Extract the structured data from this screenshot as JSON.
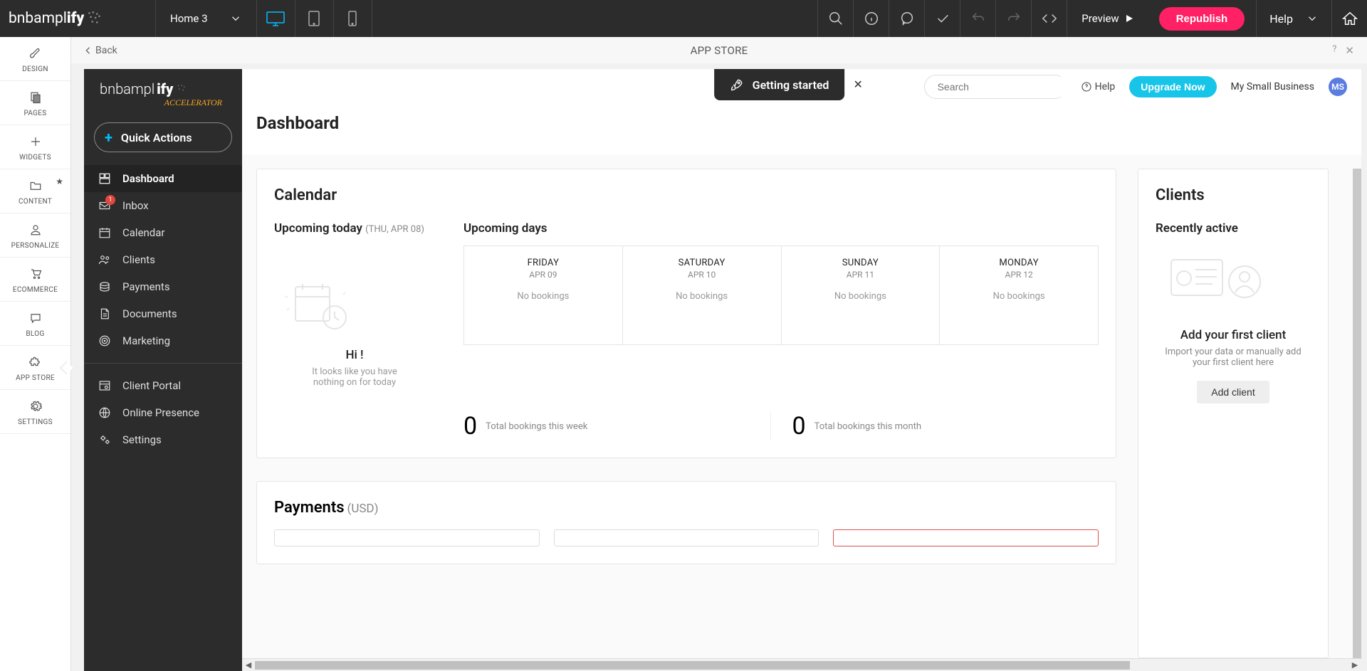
{
  "topbar": {
    "logo": "bnbamplify",
    "page": "Home 3",
    "preview": "Preview",
    "republish": "Republish",
    "help": "Help"
  },
  "leftnav": {
    "items": [
      {
        "label": "DESIGN"
      },
      {
        "label": "PAGES"
      },
      {
        "label": "WIDGETS"
      },
      {
        "label": "CONTENT"
      },
      {
        "label": "PERSONALIZE"
      },
      {
        "label": "ECOMMERCE"
      },
      {
        "label": "BLOG"
      },
      {
        "label": "APP STORE"
      },
      {
        "label": "SETTINGS"
      }
    ]
  },
  "subheader": {
    "back": "Back",
    "title": "APP STORE"
  },
  "app_sidebar": {
    "brand": "bnbamplify",
    "brand_sub": "ACCELERATOR",
    "quick": "Quick Actions",
    "nav": {
      "dashboard": "Dashboard",
      "inbox": "Inbox",
      "inbox_badge": "1",
      "calendar": "Calendar",
      "clients": "Clients",
      "payments": "Payments",
      "documents": "Documents",
      "marketing": "Marketing",
      "client_portal": "Client Portal",
      "online_presence": "Online Presence",
      "settings": "Settings"
    }
  },
  "app_topbar": {
    "getting_started": "Getting started",
    "search_placeholder": "Search",
    "help": "Help",
    "upgrade": "Upgrade Now",
    "business": "My Small Business",
    "avatar": "MS"
  },
  "dashboard": {
    "title": "Dashboard",
    "calendar": {
      "heading": "Calendar",
      "today_heading": "Upcoming today",
      "today_paren": "(THU,  APR 08)",
      "empty_hi": "Hi !",
      "empty_txt1": "It looks like you have",
      "empty_txt2": "nothing on for today",
      "days_heading": "Upcoming days",
      "days": [
        {
          "dow": "FRIDAY",
          "date": "APR 09",
          "text": "No bookings"
        },
        {
          "dow": "SATURDAY",
          "date": "APR 10",
          "text": "No bookings"
        },
        {
          "dow": "SUNDAY",
          "date": "APR 11",
          "text": "No bookings"
        },
        {
          "dow": "MONDAY",
          "date": "APR 12",
          "text": "No bookings"
        }
      ],
      "stat_week_num": "0",
      "stat_week_label": "Total bookings this week",
      "stat_month_num": "0",
      "stat_month_label": "Total bookings this month"
    },
    "payments": {
      "heading": "Payments",
      "currency": "(USD)"
    },
    "clients": {
      "heading": "Clients",
      "subhead": "Recently active",
      "empty_title": "Add your first client",
      "empty_txt1": "Import your data or manually add",
      "empty_txt2": "your first client here",
      "add_btn": "Add client"
    }
  }
}
